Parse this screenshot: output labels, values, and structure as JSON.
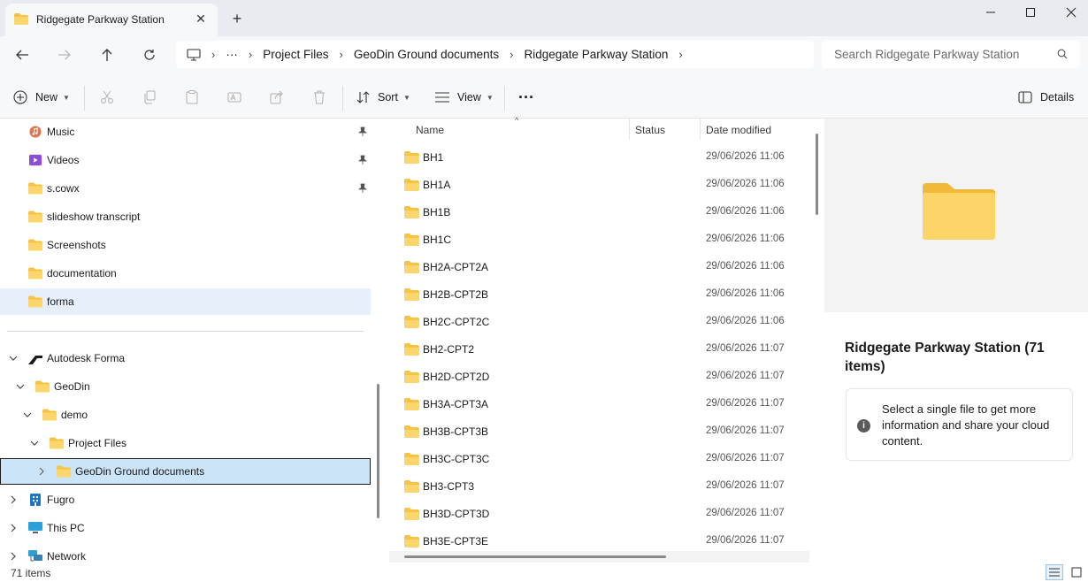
{
  "window": {
    "tab_title": "Ridgegate Parkway Station",
    "tab_close": "✕",
    "new_tab": "+",
    "folder_icon": "folder-icon",
    "colors": {
      "titlebar": "#e8ebf0",
      "chrome": "#f7f8fa",
      "folder": "#f6c344",
      "selection": "#cce4f7"
    }
  },
  "address": {
    "overflow": "···",
    "separator": "›",
    "crumbs": [
      "Project Files",
      "GeoDin Ground documents",
      "Ridgegate Parkway Station"
    ],
    "search_placeholder": "Search Ridgegate Parkway Station"
  },
  "toolbar": {
    "new_label": "New",
    "sort_label": "Sort",
    "view_label": "View",
    "more_label": "···",
    "details_label": "Details"
  },
  "nav": {
    "quick_access": [
      {
        "label": "Music",
        "icon": "music-icon",
        "pinned": true
      },
      {
        "label": "Videos",
        "icon": "videos-icon",
        "pinned": true
      },
      {
        "label": "s.cowx",
        "icon": "folder-icon",
        "pinned": true
      },
      {
        "label": "slideshow transcript",
        "icon": "folder-icon",
        "pinned": false
      },
      {
        "label": "Screenshots",
        "icon": "folder-icon",
        "pinned": false
      },
      {
        "label": "documentation",
        "icon": "folder-icon",
        "pinned": false
      },
      {
        "label": "forma",
        "icon": "folder-icon",
        "pinned": false
      }
    ],
    "tree": [
      {
        "label": "Autodesk Forma",
        "icon": "forma-icon",
        "state": "expanded"
      },
      {
        "label": "GeoDin",
        "icon": "folder-icon",
        "state": "expanded"
      },
      {
        "label": "demo",
        "icon": "folder-icon",
        "state": "expanded"
      },
      {
        "label": "Project Files",
        "icon": "folder-icon",
        "state": "expanded"
      },
      {
        "label": "GeoDin Ground documents",
        "icon": "folder-icon",
        "state": "collapsed",
        "selected": true
      },
      {
        "label": "Fugro",
        "icon": "building-icon",
        "state": "collapsed"
      },
      {
        "label": "This PC",
        "icon": "pc-icon",
        "state": "collapsed"
      },
      {
        "label": "Network",
        "icon": "network-icon",
        "state": "collapsed"
      }
    ]
  },
  "list": {
    "columns": {
      "name": "Name",
      "status": "Status",
      "date": "Date modified"
    },
    "sort_indicator": "^",
    "files": [
      {
        "name": "BH1",
        "date": "29/06/2026 11:06"
      },
      {
        "name": "BH1A",
        "date": "29/06/2026 11:06"
      },
      {
        "name": "BH1B",
        "date": "29/06/2026 11:06"
      },
      {
        "name": "BH1C",
        "date": "29/06/2026 11:06"
      },
      {
        "name": "BH2A-CPT2A",
        "date": "29/06/2026 11:06"
      },
      {
        "name": "BH2B-CPT2B",
        "date": "29/06/2026 11:06"
      },
      {
        "name": "BH2C-CPT2C",
        "date": "29/06/2026 11:06"
      },
      {
        "name": "BH2-CPT2",
        "date": "29/06/2026 11:07"
      },
      {
        "name": "BH2D-CPT2D",
        "date": "29/06/2026 11:07"
      },
      {
        "name": "BH3A-CPT3A",
        "date": "29/06/2026 11:07"
      },
      {
        "name": "BH3B-CPT3B",
        "date": "29/06/2026 11:07"
      },
      {
        "name": "BH3C-CPT3C",
        "date": "29/06/2026 11:07"
      },
      {
        "name": "BH3-CPT3",
        "date": "29/06/2026 11:07"
      },
      {
        "name": "BH3D-CPT3D",
        "date": "29/06/2026 11:07"
      },
      {
        "name": "BH3E-CPT3E",
        "date": "29/06/2026 11:07"
      }
    ]
  },
  "details": {
    "title": "Ridgegate Parkway Station (71 items)",
    "info_icon": "i",
    "info_text": "Select a single file to get more information and share your cloud content."
  },
  "status": {
    "item_count": "71 items"
  }
}
